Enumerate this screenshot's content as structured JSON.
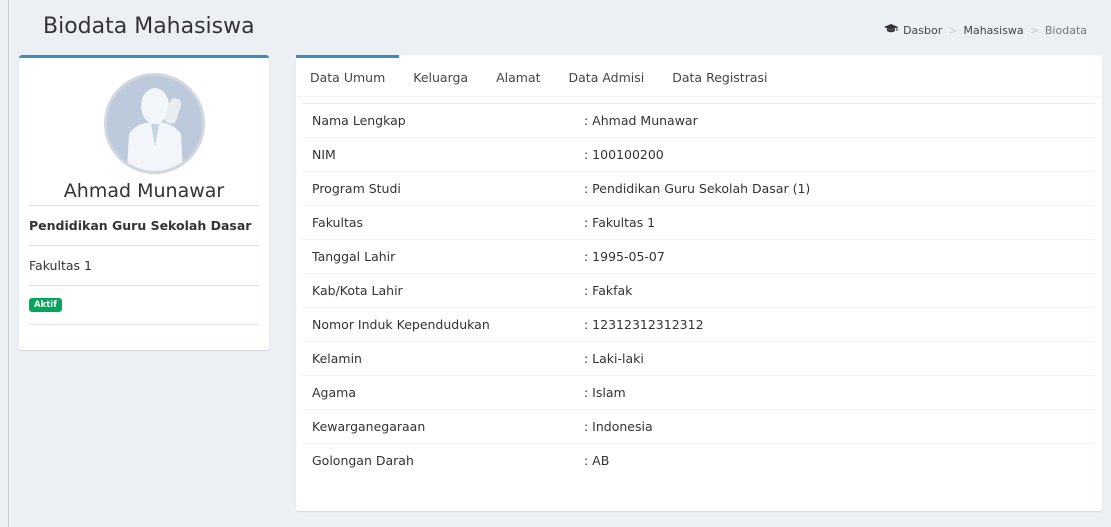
{
  "header": {
    "title": "Biodata Mahasiswa",
    "breadcrumb": [
      "Dasbor",
      "Mahasiswa",
      "Biodata"
    ],
    "breadcrumb_separator": ">"
  },
  "profile": {
    "name": "Ahmad Munawar",
    "program": "Pendidikan Guru Sekolah Dasar",
    "faculty": "Fakultas 1",
    "status": "Aktif"
  },
  "tabs": [
    "Data Umum",
    "Keluarga",
    "Alamat",
    "Data Admisi",
    "Data Registrasi"
  ],
  "active_tab": "Data Umum",
  "fields": [
    {
      "label": "Nama Lengkap",
      "value": ": Ahmad Munawar"
    },
    {
      "label": "NIM",
      "value": ": 100100200"
    },
    {
      "label": "Program Studi",
      "value": ": Pendidikan Guru Sekolah Dasar (1)"
    },
    {
      "label": "Fakultas",
      "value": ": Fakultas 1"
    },
    {
      "label": "Tanggal Lahir",
      "value": ": 1995-05-07"
    },
    {
      "label": "Kab/Kota Lahir",
      "value": ": Fakfak"
    },
    {
      "label": "Nomor Induk Kependudukan",
      "value": ": 12312312312312"
    },
    {
      "label": "Kelamin",
      "value": ": Laki-laki"
    },
    {
      "label": "Agama",
      "value": ": Islam"
    },
    {
      "label": "Kewarganegaraan",
      "value": ": Indonesia"
    },
    {
      "label": "Golongan Darah",
      "value": ": AB"
    }
  ],
  "icons": {
    "breadcrumb_home": "graduation-cap-icon",
    "avatar": "user-silhouette-icon"
  },
  "colors": {
    "accent": "#3c8dbc",
    "status": "#00a65a",
    "background": "#ecf0f5"
  }
}
